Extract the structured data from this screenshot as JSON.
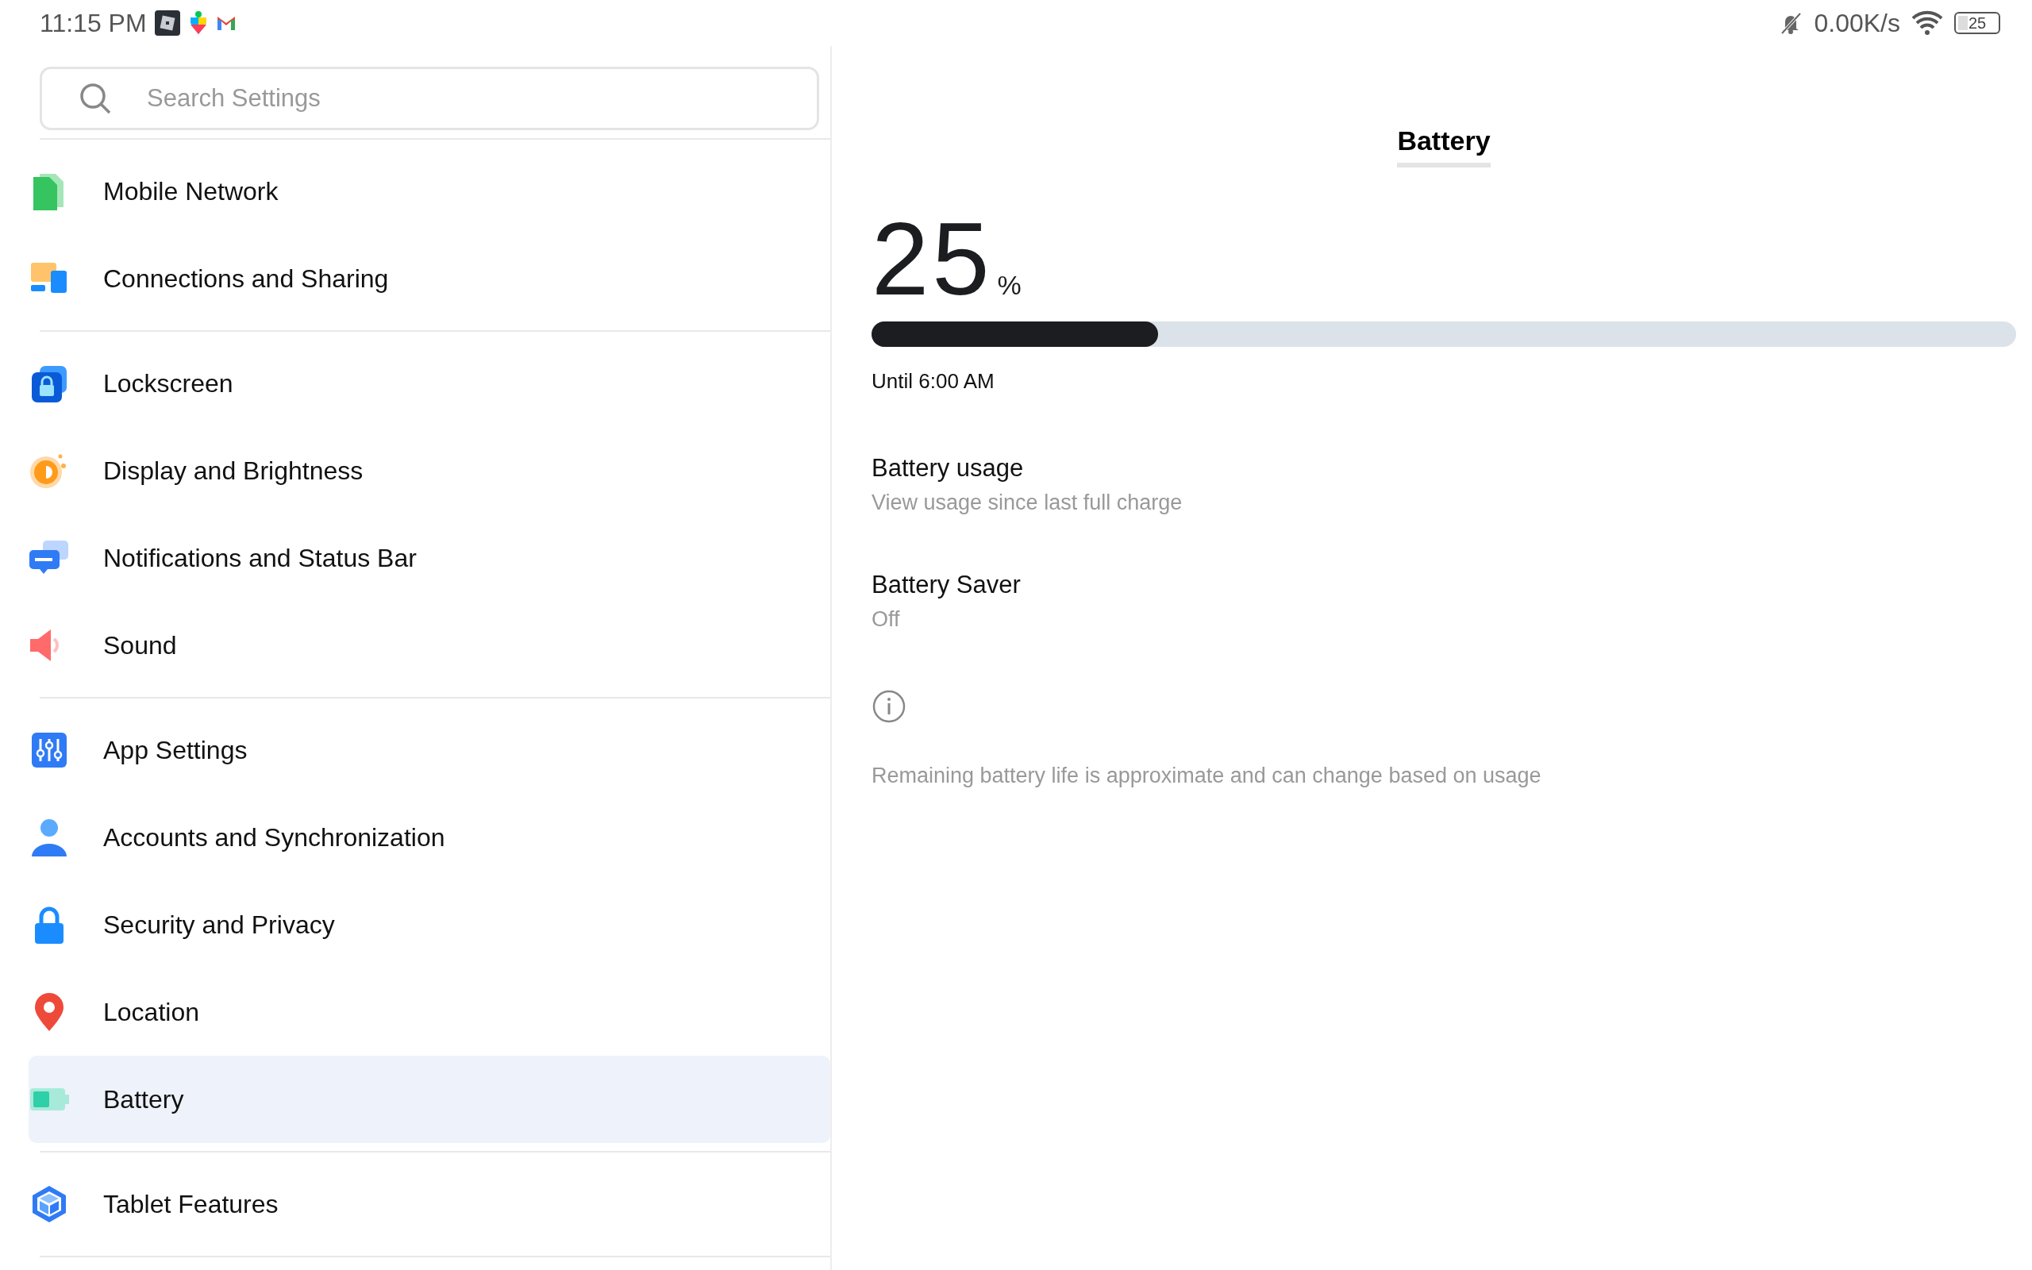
{
  "status_bar": {
    "time": "11:15 PM",
    "speed": "0.00K/s",
    "battery_text": "25"
  },
  "sidebar": {
    "search": {
      "placeholder": "Search Settings"
    },
    "groups": [
      {
        "items": [
          {
            "label": "Mobile Network",
            "kind": "sim",
            "selected": false
          },
          {
            "label": "Connections and Sharing",
            "kind": "connections",
            "selected": false
          }
        ]
      },
      {
        "items": [
          {
            "label": "Lockscreen",
            "kind": "lock-screen",
            "selected": false
          },
          {
            "label": "Display and Brightness",
            "kind": "brightness",
            "selected": false
          },
          {
            "label": "Notifications and Status Bar",
            "kind": "chat",
            "selected": false
          },
          {
            "label": "Sound",
            "kind": "speaker",
            "selected": false
          }
        ]
      },
      {
        "items": [
          {
            "label": "App Settings",
            "kind": "sliders",
            "selected": false
          },
          {
            "label": "Accounts and Synchronization",
            "kind": "person",
            "selected": false
          },
          {
            "label": "Security and Privacy",
            "kind": "padlock",
            "selected": false
          },
          {
            "label": "Location",
            "kind": "pin",
            "selected": false
          },
          {
            "label": "Battery",
            "kind": "battery",
            "selected": true
          }
        ]
      },
      {
        "items": [
          {
            "label": "Tablet Features",
            "kind": "cube",
            "selected": false
          }
        ]
      }
    ]
  },
  "detail": {
    "title": "Battery",
    "percent": "25",
    "percent_sign": "%",
    "level": 0.25,
    "until": "Until 6:00 AM",
    "rows": [
      {
        "title": "Battery usage",
        "subtitle": "View usage since last full charge"
      },
      {
        "title": "Battery Saver",
        "subtitle": "Off"
      }
    ],
    "note": "Remaining battery life is approximate and can change based on usage"
  }
}
